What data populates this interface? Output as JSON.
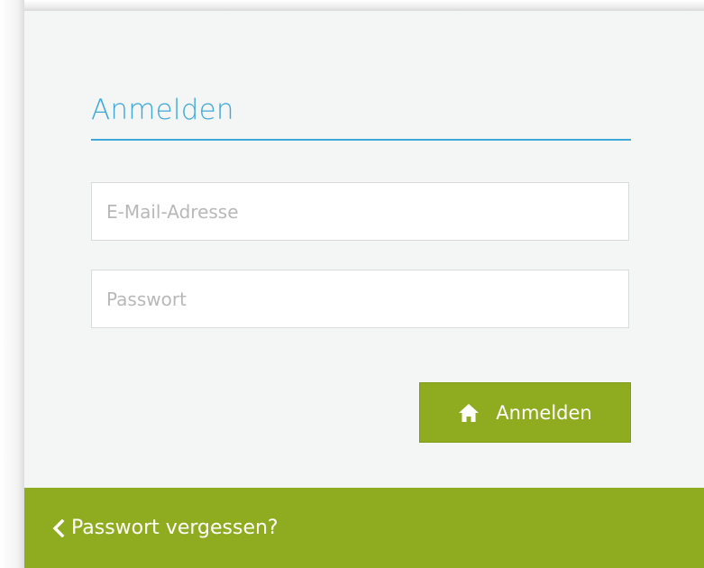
{
  "login_form": {
    "title": "Anmelden",
    "email": {
      "placeholder": "E-Mail-Adresse",
      "value": ""
    },
    "password": {
      "placeholder": "Passwort",
      "value": ""
    },
    "submit": {
      "label": "Anmelden",
      "icon": "home-icon"
    }
  },
  "footer": {
    "forgot_password_label": "Passwort vergessen?",
    "icon": "chevron-left-icon"
  },
  "colors": {
    "accent_blue": "#3ea8d8",
    "brand_green": "#8fac20",
    "panel_background": "#f4f5f5"
  }
}
